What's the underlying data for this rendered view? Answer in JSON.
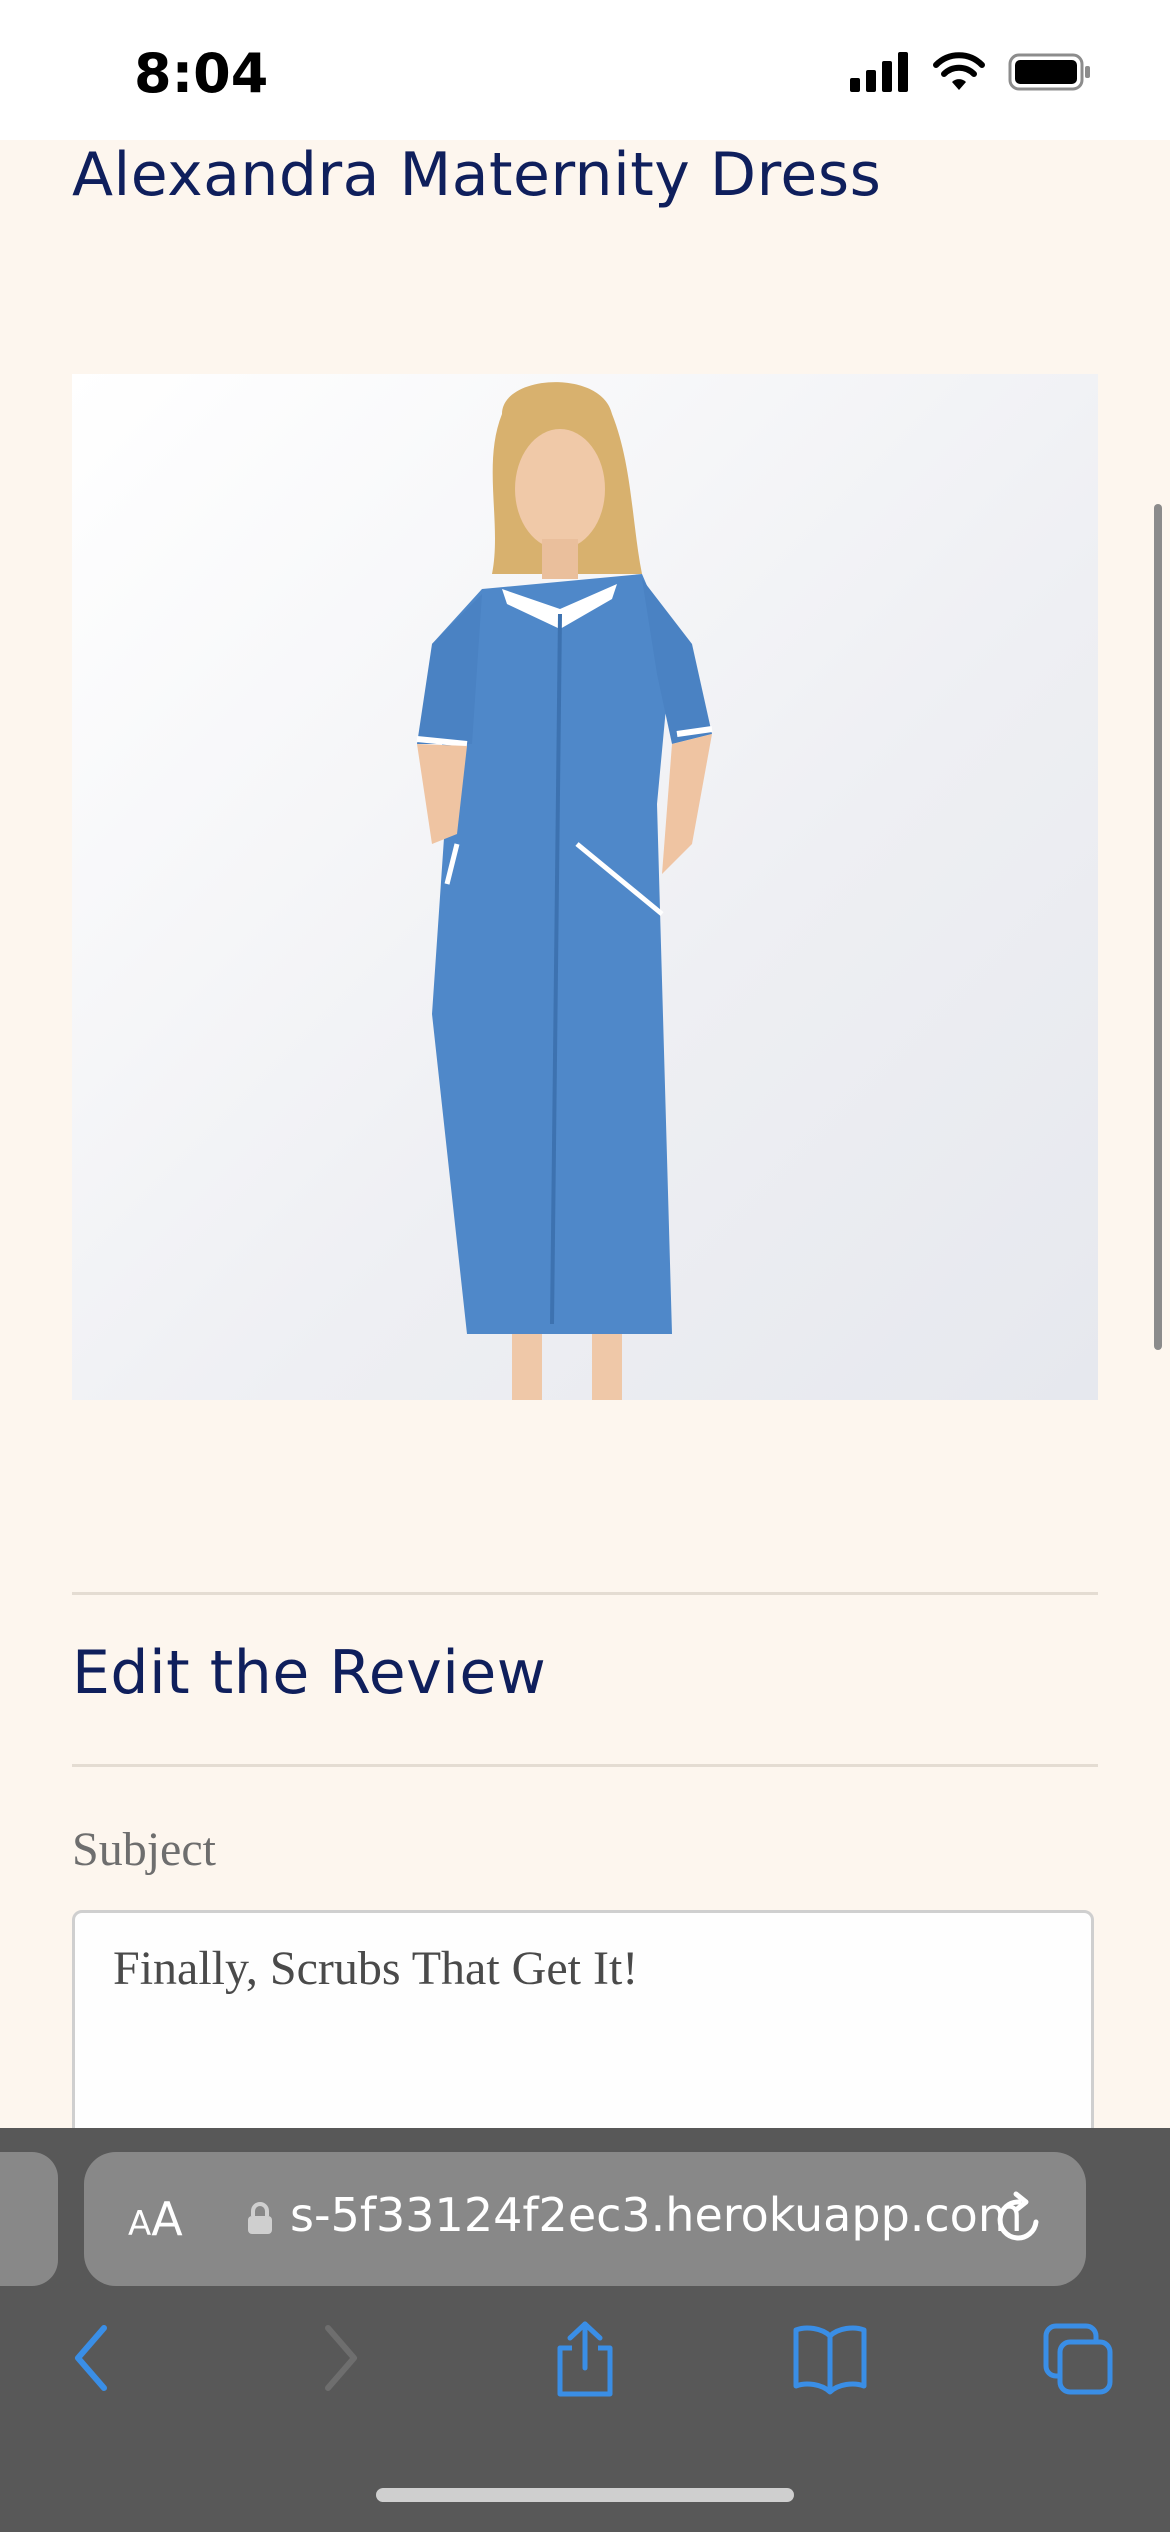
{
  "status_bar": {
    "time": "8:04"
  },
  "product": {
    "title": "Alexandra Maternity Dress"
  },
  "review": {
    "section_title": "Edit the Review",
    "subject_label": "Subject",
    "subject_value": "Finally, Scrubs That Get It!"
  },
  "browser": {
    "text_size_label": "AA",
    "url": "s-5f33124f2ec3.herokuapp.com"
  },
  "colors": {
    "accent": "#0f1f5c",
    "page_background": "#fdf6ee",
    "toolbar": "#585858",
    "nav_icon_blue": "#3a8ee6"
  },
  "icons": [
    "signal-icon",
    "wifi-icon",
    "battery-icon",
    "lock-icon",
    "reload-icon",
    "back-icon",
    "forward-icon",
    "share-icon",
    "bookmarks-icon",
    "tabs-icon"
  ]
}
